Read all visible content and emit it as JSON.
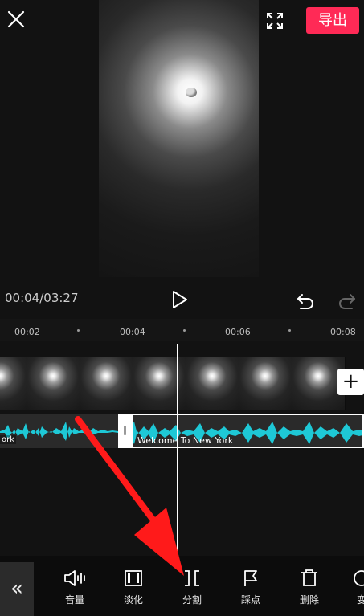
{
  "top_bar": {
    "export_label": "导出"
  },
  "player": {
    "time": "00:04/03:27"
  },
  "ruler": {
    "ticks": [
      "00:02",
      "00:04",
      "00:06",
      "00:08"
    ]
  },
  "audio": {
    "left_clip_label": "ork",
    "right_clip_label": "Welcome To New York"
  },
  "add_clip": "+",
  "toolbar": {
    "collapse": "«",
    "tools": [
      {
        "label": "音量",
        "icon": "volume-icon"
      },
      {
        "label": "淡化",
        "icon": "fade-icon"
      },
      {
        "label": "分割",
        "icon": "split-icon"
      },
      {
        "label": "踩点",
        "icon": "flag-icon"
      },
      {
        "label": "删除",
        "icon": "delete-icon"
      },
      {
        "label": "变",
        "icon": "speed-icon"
      }
    ]
  },
  "colors": {
    "export": "#ff2a56",
    "waveform": "#1ec8d6",
    "arrow": "#ff1a1a"
  }
}
